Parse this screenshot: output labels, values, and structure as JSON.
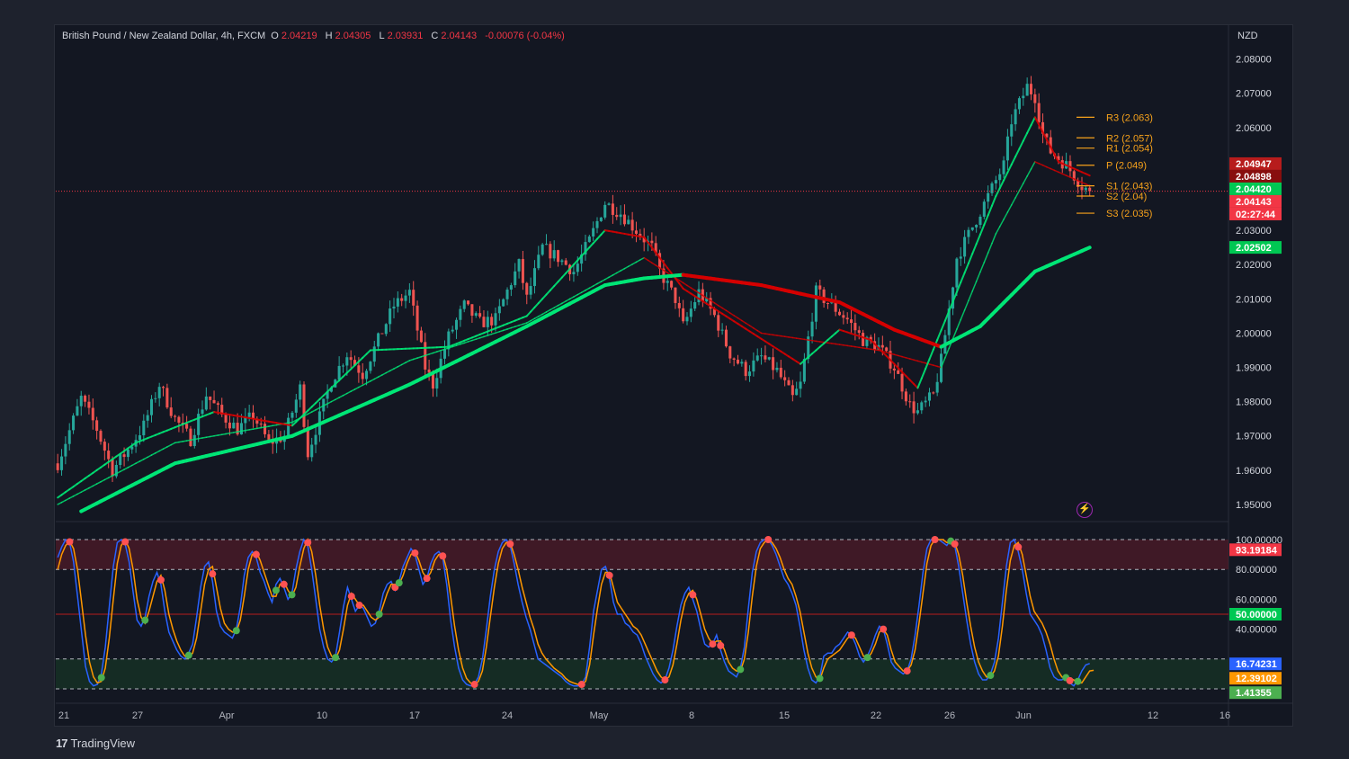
{
  "legend": {
    "symbol": "British Pound / New Zealand Dollar, 4h, FXCM",
    "o_label": "O",
    "o_value": "2.04219",
    "h_label": "H",
    "h_value": "2.04305",
    "l_label": "L",
    "l_value": "2.03931",
    "c_label": "C",
    "c_value": "2.04143",
    "change": "-0.00076 (-0.04%)"
  },
  "currency": "NZD",
  "brand": {
    "logo": "17",
    "name": "TradingView"
  },
  "colors": {
    "up": "#26a69a",
    "down": "#ef5350",
    "bg": "#131722",
    "ema_green": "#00e676",
    "ema_red": "#d50000",
    "pivot": "#f7a21b",
    "stoch_k": "#2962ff",
    "stoch_d": "#ff9800"
  },
  "icons": {
    "bolt": "lightning-icon"
  },
  "chart_data": [
    {
      "type": "candlestick",
      "title": "British Pound / New Zealand Dollar, 4h, FXCM",
      "y_unit": "NZD",
      "ylim": [
        1.945,
        2.082
      ],
      "y_ticks": [
        "2.08000",
        "2.07000",
        "2.06000",
        "2.05000",
        "2.04000",
        "2.03000",
        "2.02000",
        "2.01000",
        "2.00000",
        "1.99000",
        "1.98000",
        "1.97000",
        "1.96000",
        "1.95000"
      ],
      "x_ticks": [
        "21",
        "27",
        "Apr",
        "10",
        "17",
        "24",
        "May",
        "8",
        "15",
        "22",
        "26",
        "Jun",
        "12",
        "16"
      ],
      "close_path": [
        [
          0,
          1.962
        ],
        [
          6,
          1.981
        ],
        [
          10,
          1.972
        ],
        [
          14,
          1.96
        ],
        [
          18,
          1.966
        ],
        [
          22,
          1.973
        ],
        [
          26,
          1.985
        ],
        [
          30,
          1.975
        ],
        [
          34,
          1.969
        ],
        [
          38,
          1.982
        ],
        [
          42,
          1.976
        ],
        [
          46,
          1.972
        ],
        [
          50,
          1.976
        ],
        [
          54,
          1.968
        ],
        [
          58,
          1.97
        ],
        [
          62,
          1.984
        ],
        [
          64,
          1.965
        ],
        [
          66,
          1.972
        ],
        [
          70,
          1.986
        ],
        [
          74,
          1.994
        ],
        [
          78,
          1.988
        ],
        [
          82,
          1.998
        ],
        [
          86,
          2.008
        ],
        [
          90,
          2.012
        ],
        [
          94,
          1.99
        ],
        [
          96,
          1.985
        ],
        [
          100,
          1.999
        ],
        [
          104,
          2.008
        ],
        [
          108,
          2.003
        ],
        [
          112,
          2.004
        ],
        [
          116,
          2.015
        ],
        [
          118,
          2.02
        ],
        [
          120,
          2.01
        ],
        [
          124,
          2.025
        ],
        [
          128,
          2.022
        ],
        [
          132,
          2.018
        ],
        [
          136,
          2.027
        ],
        [
          140,
          2.038
        ],
        [
          144,
          2.035
        ],
        [
          148,
          2.03
        ],
        [
          152,
          2.025
        ],
        [
          154,
          2.018
        ],
        [
          158,
          2.01
        ],
        [
          160,
          2.002
        ],
        [
          164,
          2.012
        ],
        [
          168,
          2.005
        ],
        [
          172,
          1.994
        ],
        [
          176,
          1.989
        ],
        [
          180,
          1.993
        ],
        [
          184,
          1.989
        ],
        [
          188,
          1.981
        ],
        [
          190,
          1.985
        ],
        [
          194,
          2.012
        ],
        [
          198,
          2.008
        ],
        [
          202,
          2.004
        ],
        [
          206,
          1.998
        ],
        [
          210,
          1.996
        ],
        [
          214,
          1.99
        ],
        [
          218,
          1.979
        ],
        [
          220,
          1.977
        ],
        [
          224,
          1.982
        ],
        [
          226,
          1.992
        ],
        [
          230,
          2.022
        ],
        [
          234,
          2.031
        ],
        [
          238,
          2.04
        ],
        [
          242,
          2.049
        ],
        [
          244,
          2.062
        ],
        [
          248,
          2.072
        ],
        [
          250,
          2.069
        ],
        [
          252,
          2.058
        ],
        [
          254,
          2.053
        ],
        [
          258,
          2.049
        ],
        [
          262,
          2.043
        ],
        [
          264,
          2.0414
        ]
      ],
      "ema_green_fast": [
        [
          0,
          1.952
        ],
        [
          20,
          1.968
        ],
        [
          40,
          1.977
        ],
        [
          60,
          1.973
        ],
        [
          80,
          1.995
        ],
        [
          100,
          1.996
        ],
        [
          120,
          2.005
        ],
        [
          140,
          2.03
        ],
        [
          150,
          2.028
        ],
        [
          160,
          2.013
        ],
        [
          190,
          1.991
        ],
        [
          200,
          2.001
        ],
        [
          208,
          1.998
        ],
        [
          220,
          1.984
        ],
        [
          230,
          2.012
        ],
        [
          240,
          2.04
        ],
        [
          250,
          2.063
        ],
        [
          256,
          2.05
        ],
        [
          264,
          2.046
        ]
      ],
      "ema_slow_mid": [
        [
          0,
          1.95
        ],
        [
          30,
          1.968
        ],
        [
          60,
          1.974
        ],
        [
          90,
          1.992
        ],
        [
          120,
          2.003
        ],
        [
          150,
          2.022
        ],
        [
          180,
          2.0
        ],
        [
          210,
          1.995
        ],
        [
          226,
          1.99
        ],
        [
          240,
          2.029
        ],
        [
          250,
          2.05
        ],
        [
          264,
          2.043
        ]
      ],
      "ema_long": [
        [
          6,
          1.948
        ],
        [
          30,
          1.962
        ],
        [
          60,
          1.97
        ],
        [
          90,
          1.985
        ],
        [
          120,
          2.002
        ],
        [
          140,
          2.014
        ],
        [
          150,
          2.016
        ],
        [
          160,
          2.017
        ],
        [
          180,
          2.014
        ],
        [
          200,
          2.009
        ],
        [
          214,
          2.001
        ],
        [
          226,
          1.996
        ],
        [
          236,
          2.002
        ],
        [
          250,
          2.018
        ],
        [
          264,
          2.025
        ]
      ],
      "pivot_levels": [
        {
          "name": "R3",
          "label": "R3 (2.063)",
          "value": 2.063
        },
        {
          "name": "R2",
          "label": "R2 (2.057)",
          "value": 2.057
        },
        {
          "name": "R1",
          "label": "R1 (2.054)",
          "value": 2.054
        },
        {
          "name": "P",
          "label": "P (2.049)",
          "value": 2.049
        },
        {
          "name": "S1",
          "label": "S1 (2.043)",
          "value": 2.043
        },
        {
          "name": "S2",
          "label": "S2 (2.04)",
          "value": 2.04
        },
        {
          "name": "S3",
          "label": "S3 (2.035)",
          "value": 2.035
        }
      ],
      "price_badges": [
        {
          "text": "2.04947",
          "value": 2.04947,
          "color": "#b71c1c"
        },
        {
          "text": "2.04898",
          "value": 2.04898,
          "color": "#880e0e"
        },
        {
          "text": "2.04420",
          "value": 2.0442,
          "color": "#00c853"
        },
        {
          "text": "2.04143",
          "value": 2.04143,
          "color": "#f23645"
        },
        {
          "text": "02:27:44",
          "value": 2.038,
          "color": "#f23645"
        },
        {
          "text": "2.02502",
          "value": 2.02502,
          "color": "#00c853"
        }
      ],
      "last_price": 2.04143
    },
    {
      "type": "line",
      "title": "",
      "ylim": [
        0,
        100
      ],
      "y_ticks": [
        "100.00000",
        "80.00000",
        "60.00000",
        "50.00000",
        "40.00000"
      ],
      "bands": {
        "overbought": 80,
        "oversold": 20,
        "mid": 50
      },
      "series": [
        {
          "values": [
            88,
            95,
            100,
            98,
            85,
            62,
            38,
            15,
            5,
            2,
            3,
            10,
            28,
            55,
            82,
            98,
            100,
            97,
            85,
            65,
            46,
            42,
            48,
            62,
            72,
            78,
            70,
            52,
            38,
            32,
            26,
            22,
            20,
            24,
            30,
            48,
            68,
            82,
            85,
            72,
            52,
            42,
            38,
            36,
            34,
            40,
            55,
            76,
            88,
            92,
            88,
            78,
            72,
            64,
            58,
            70,
            74,
            68,
            60,
            64,
            80,
            92,
            100,
            96,
            80,
            60,
            40,
            28,
            20,
            18,
            22,
            38,
            55,
            68,
            60,
            52,
            56,
            54,
            48,
            42,
            44,
            52,
            64,
            70,
            72,
            66,
            72,
            82,
            88,
            94,
            90,
            80,
            70,
            74,
            84,
            90,
            92,
            88,
            70,
            46,
            28,
            14,
            6,
            3,
            2,
            3,
            8,
            20,
            40,
            62,
            80,
            92,
            98,
            100,
            96,
            84,
            70,
            58,
            48,
            40,
            30,
            20,
            18,
            16,
            14,
            12,
            10,
            8,
            5,
            3,
            2,
            2,
            3,
            8,
            28,
            52,
            66,
            80,
            82,
            74,
            58,
            50,
            50,
            44,
            42,
            38,
            36,
            30,
            22,
            16,
            10,
            6,
            4,
            6,
            14,
            26,
            42,
            56,
            64,
            68,
            60,
            52,
            40,
            30,
            28,
            30,
            36,
            26,
            18,
            12,
            10,
            8,
            14,
            28,
            54,
            78,
            92,
            98,
            100,
            100,
            96,
            90,
            82,
            74,
            70,
            64,
            56,
            42,
            26,
            14,
            6,
            4,
            8,
            22,
            24,
            24,
            28,
            30,
            34,
            38,
            36,
            30,
            22,
            18,
            22,
            28,
            36,
            42,
            40,
            30,
            18,
            14,
            12,
            10,
            12,
            20,
            36,
            56,
            78,
            94,
            100,
            100,
            100,
            98,
            96,
            100,
            96,
            82,
            64,
            46,
            30,
            18,
            10,
            6,
            6,
            10,
            18,
            34,
            58,
            82,
            98,
            100,
            92,
            80,
            64,
            50,
            46,
            42,
            36,
            26,
            14,
            8,
            6,
            6,
            8,
            4,
            2,
            6,
            12,
            16,
            17
          ]
        },
        {
          "values": [
            80,
            90,
            96,
            99,
            94,
            80,
            58,
            36,
            18,
            8,
            4,
            5,
            14,
            34,
            60,
            84,
            96,
            100,
            94,
            80,
            60,
            48,
            44,
            52,
            62,
            72,
            76,
            66,
            50,
            40,
            32,
            26,
            22,
            21,
            24,
            34,
            52,
            70,
            80,
            82,
            68,
            54,
            44,
            40,
            38,
            38,
            46,
            62,
            80,
            90,
            92,
            86,
            78,
            70,
            62,
            62,
            70,
            72,
            66,
            62,
            68,
            82,
            94,
            100,
            92,
            76,
            56,
            40,
            28,
            22,
            20,
            26,
            40,
            56,
            64,
            60,
            56,
            56,
            52,
            48,
            46,
            48,
            56,
            64,
            70,
            70,
            70,
            76,
            84,
            90,
            92,
            86,
            78,
            74,
            78,
            86,
            90,
            90,
            80,
            62,
            42,
            26,
            14,
            7,
            4,
            3,
            5,
            12,
            28,
            48,
            68,
            84,
            94,
            98,
            98,
            90,
            80,
            68,
            58,
            48,
            40,
            30,
            24,
            20,
            17,
            14,
            12,
            10,
            7,
            5,
            4,
            3,
            3,
            5,
            16,
            36,
            54,
            70,
            78,
            78,
            68,
            58,
            54,
            50,
            46,
            42,
            40,
            36,
            30,
            24,
            18,
            12,
            8,
            6,
            8,
            16,
            30,
            46,
            58,
            64,
            66,
            60,
            50,
            40,
            34,
            30,
            32,
            32,
            26,
            18,
            14,
            12,
            12,
            20,
            38,
            62,
            82,
            94,
            98,
            100,
            98,
            94,
            88,
            80,
            74,
            70,
            62,
            52,
            38,
            24,
            14,
            8,
            6,
            14,
            20,
            22,
            24,
            26,
            30,
            34,
            36,
            34,
            28,
            22,
            20,
            24,
            30,
            38,
            40,
            36,
            26,
            18,
            15,
            12,
            12,
            16,
            26,
            44,
            64,
            84,
            96,
            100,
            100,
            100,
            98,
            98,
            98,
            90,
            76,
            58,
            42,
            28,
            18,
            12,
            8,
            8,
            12,
            22,
            42,
            66,
            86,
            96,
            98,
            90,
            76,
            62,
            52,
            48,
            44,
            38,
            30,
            20,
            12,
            8,
            7,
            7,
            6,
            4,
            4,
            8,
            12,
            12.4
          ]
        }
      ],
      "value_badges": [
        {
          "text": "93.19184",
          "value": 93.19184,
          "color": "#f23645"
        },
        {
          "text": "50.00000",
          "value": 50,
          "color": "#00c853"
        },
        {
          "text": "16.74231",
          "value": 16.74231,
          "color": "#2962ff"
        },
        {
          "text": "12.39102",
          "value": 12.39102,
          "color": "#ff9800"
        },
        {
          "text": "1.41355",
          "value": 1.41355,
          "color": "#4caf50"
        }
      ]
    }
  ]
}
